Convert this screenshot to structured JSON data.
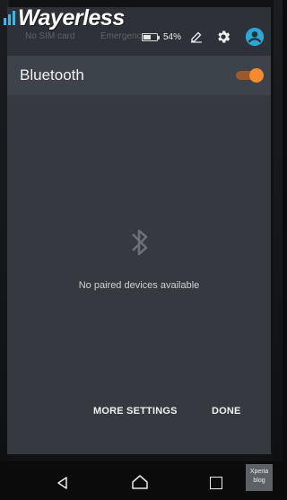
{
  "status_bar": {
    "brand": "Wayerless",
    "left_faint_text": "No SIM card",
    "carrier_faint_text": "Emergency",
    "battery_percent": "54%",
    "battery_level": 0.54,
    "icons": [
      "battery-icon",
      "edit-icon",
      "gear-icon",
      "account-icon"
    ]
  },
  "header": {
    "title": "Bluetooth",
    "toggle_on": true
  },
  "content": {
    "empty_message": "No paired devices available",
    "icon": "bluetooth-icon"
  },
  "actions": {
    "more_settings": "MORE SETTINGS",
    "done": "DONE"
  },
  "nav": {
    "icons": [
      "back-icon",
      "home-icon",
      "recent-apps-icon"
    ]
  },
  "watermark": {
    "line1": "Xperia",
    "line2": "blog"
  },
  "colors": {
    "accent": "#f28a2e",
    "panel": "#343a40",
    "header": "#3d434a",
    "account": "#2aa8d8"
  }
}
